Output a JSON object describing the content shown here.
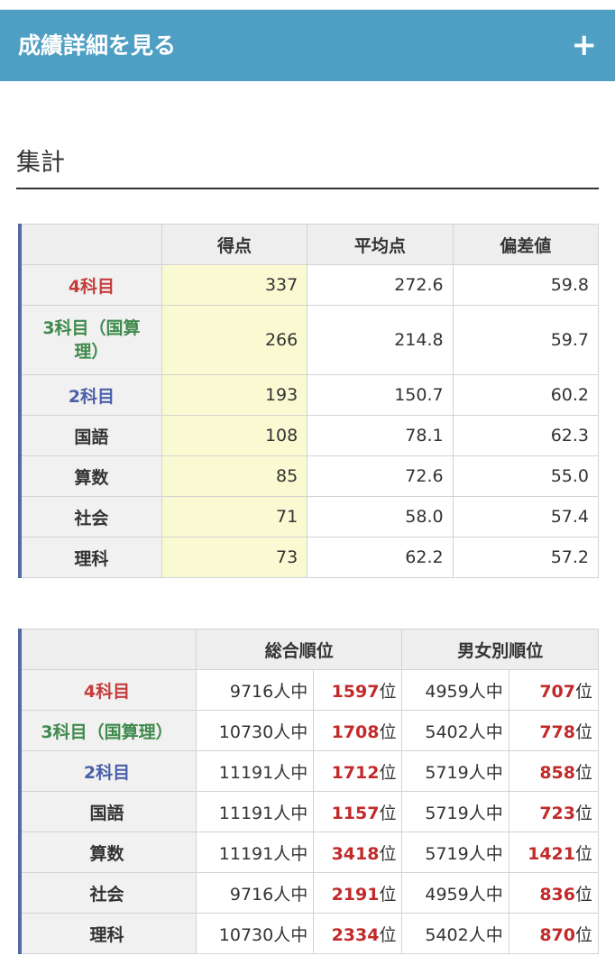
{
  "header": {
    "title": "成績詳細を見る",
    "toggle_icon": "plus-icon",
    "toggle_glyph": "+"
  },
  "section": {
    "title": "集計"
  },
  "colors": {
    "header_bg": "#4f9fc4",
    "subject_red": "#c43c3c",
    "subject_green": "#3f8a4c",
    "subject_blue": "#4a5fa8",
    "rank_red": "#c22a2a",
    "score_highlight": "#fafad2",
    "table_accent": "#5569a7"
  },
  "scores_table": {
    "columns": [
      "得点",
      "平均点",
      "偏差値"
    ],
    "rows": [
      {
        "subject": "4科目",
        "score": "337",
        "average": "272.6",
        "deviation": "59.8"
      },
      {
        "subject": "3科目（国算理）",
        "score": "266",
        "average": "214.8",
        "deviation": "59.7"
      },
      {
        "subject": "2科目",
        "score": "193",
        "average": "150.7",
        "deviation": "60.2"
      },
      {
        "subject": "国語",
        "score": "108",
        "average": "78.1",
        "deviation": "62.3"
      },
      {
        "subject": "算数",
        "score": "85",
        "average": "72.6",
        "deviation": "55.0"
      },
      {
        "subject": "社会",
        "score": "71",
        "average": "58.0",
        "deviation": "57.4"
      },
      {
        "subject": "理科",
        "score": "73",
        "average": "62.2",
        "deviation": "57.2"
      }
    ]
  },
  "rank_table": {
    "columns": [
      "総合順位",
      "男女別順位"
    ],
    "rank_suffix": "位",
    "rows": [
      {
        "subject": "4科目",
        "overall_total": "9716人中",
        "overall_rank": "1597",
        "gender_total": "4959人中",
        "gender_rank": "707"
      },
      {
        "subject": "3科目（国算理）",
        "overall_total": "10730人中",
        "overall_rank": "1708",
        "gender_total": "5402人中",
        "gender_rank": "778"
      },
      {
        "subject": "2科目",
        "overall_total": "11191人中",
        "overall_rank": "1712",
        "gender_total": "5719人中",
        "gender_rank": "858"
      },
      {
        "subject": "国語",
        "overall_total": "11191人中",
        "overall_rank": "1157",
        "gender_total": "5719人中",
        "gender_rank": "723"
      },
      {
        "subject": "算数",
        "overall_total": "11191人中",
        "overall_rank": "3418",
        "gender_total": "5719人中",
        "gender_rank": "1421"
      },
      {
        "subject": "社会",
        "overall_total": "9716人中",
        "overall_rank": "2191",
        "gender_total": "4959人中",
        "gender_rank": "836"
      },
      {
        "subject": "理科",
        "overall_total": "10730人中",
        "overall_rank": "2334",
        "gender_total": "5402人中",
        "gender_rank": "870"
      }
    ]
  }
}
